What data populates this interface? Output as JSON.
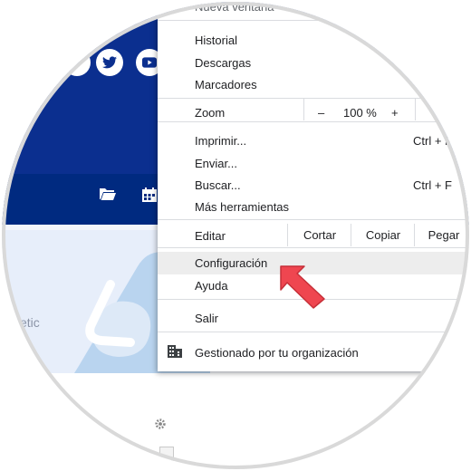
{
  "menu": {
    "top_item_partial": "Nueva ventana",
    "group1": [
      "Historial",
      "Descargas",
      "Marcadores"
    ],
    "zoom": {
      "label": "Zoom",
      "minus": "–",
      "value": "100 %",
      "plus": "+"
    },
    "group3": {
      "print": "Imprimir...",
      "print_shortcut": "Ctrl + P",
      "send": "Enviar...",
      "find": "Buscar...",
      "find_shortcut": "Ctrl + F",
      "more_tools": "Más herramientas"
    },
    "edit": {
      "label": "Editar",
      "cut": "Cortar",
      "copy": "Copiar",
      "paste": "Pegar"
    },
    "settings": "Configuración",
    "help": "Ayuda",
    "exit": "Salir",
    "managed": "Gestionado por tu organización"
  },
  "page": {
    "banner_text": "etic"
  },
  "colors": {
    "hero_blue": "#0b2f8f",
    "nav_blue": "#002a80",
    "pointer_red": "#ef4650",
    "menu_highlight": "#ededed"
  },
  "icons": [
    "twitter-icon",
    "youtube-icon",
    "folder-icon",
    "calendar-icon",
    "building-icon",
    "gear-icon",
    "pointer-arrow-icon"
  ]
}
